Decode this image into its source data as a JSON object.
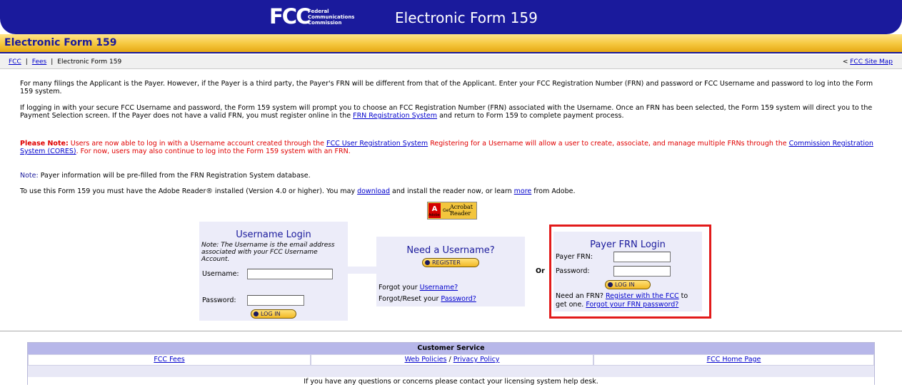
{
  "header": {
    "logo_mark": "FCC",
    "logo_text_1": "Federal",
    "logo_text_2": "Communications",
    "logo_text_3": "Commission",
    "title": "Electronic Form 159"
  },
  "title_bar": {
    "title": "Electronic Form 159"
  },
  "breadcrumb": {
    "items": [
      "FCC",
      "Fees",
      "Electronic Form 159"
    ],
    "sitemap_prefix": "<",
    "sitemap_label": "FCC Site Map"
  },
  "intro": {
    "p1": "For many filings the Applicant is the Payer. However, if the Payer is a third party, the Payer's FRN will be different from that of the Applicant. Enter your FCC Registration Number (FRN) and password or FCC Username and password to log into the Form 159 system.",
    "p2_a": "If logging in with your secure FCC Username and password, the Form 159 system will prompt you to choose an FCC Registration Number (FRN) associated with the Username. Once an FRN has been selected, the Form 159 system will direct you to the Payment Selection screen.  If the Payer does not have a valid FRN, you must register online in the ",
    "p2_link": "FRN Registration System",
    "p2_b": " and return to Form 159 to complete payment process."
  },
  "please_note": {
    "label": "Please Note:",
    "text_a": " Users are now able to log in with a Username account created through the ",
    "link1": "FCC User Registration System",
    "text_b": "  Registering for a Username will allow a user to create, associate, and manage multiple FRNs through the ",
    "link2": "Commission Registration System (CORES)",
    "text_c": ".  For now, users may also continue to log into the Form 159 system with an FRN."
  },
  "note": {
    "label": "Note:",
    "text": " Payer information will be pre-filled from the FRN Registration System database."
  },
  "adobe_info": {
    "text_a": "To use this Form 159 you must have the Adobe Reader® installed (Version 4.0 or higher). You may ",
    "link_download": "download",
    "text_b": " and install the reader now, or learn ",
    "link_more": "more",
    "text_c": " from Adobe."
  },
  "adobe_badge": {
    "logo": "A",
    "sub": "Adobe",
    "get": "Get",
    "line1": "Acrobat",
    "line2": "Reader"
  },
  "username_login": {
    "title": "Username Login",
    "note": "Note: The Username is the email address associated with your FCC Username Account.",
    "username_label": "Username:",
    "username_value": "",
    "password_label": "Password:",
    "password_value": "",
    "login_button": "LOG IN"
  },
  "need_username": {
    "title": "Need a Username?",
    "register_button": "REGISTER",
    "forgot_username_prefix": "Forgot your ",
    "forgot_username_link": "Username?",
    "forgot_password_prefix": "Forgot/Reset your ",
    "forgot_password_link": "Password?"
  },
  "or_label": "Or",
  "payer_frn_login": {
    "title": "Payer FRN Login",
    "frn_label": "Payer FRN:",
    "frn_value": "",
    "password_label": "Password:",
    "password_value": "",
    "login_button": "LOG IN",
    "need_frn_prefix": "Need an FRN? ",
    "register_link": "Register with the FCC",
    "need_frn_suffix": " to get one. ",
    "forgot_link": "Forgot your FRN password?"
  },
  "customer_service": {
    "header": "Customer Service",
    "links": {
      "fees": "FCC Fees",
      "web_policies": "Web Policies",
      "divider": " / ",
      "privacy": "Privacy Policy",
      "home": "FCC Home Page"
    },
    "contact_text": "If you have any questions or concerns please contact your licensing system help desk."
  },
  "colors": {
    "banner": "#1a1a9c",
    "gold": "#f5c73e",
    "panel": "#ececf9",
    "highlight": "#e21a1a",
    "warning_text": "#e00000"
  }
}
